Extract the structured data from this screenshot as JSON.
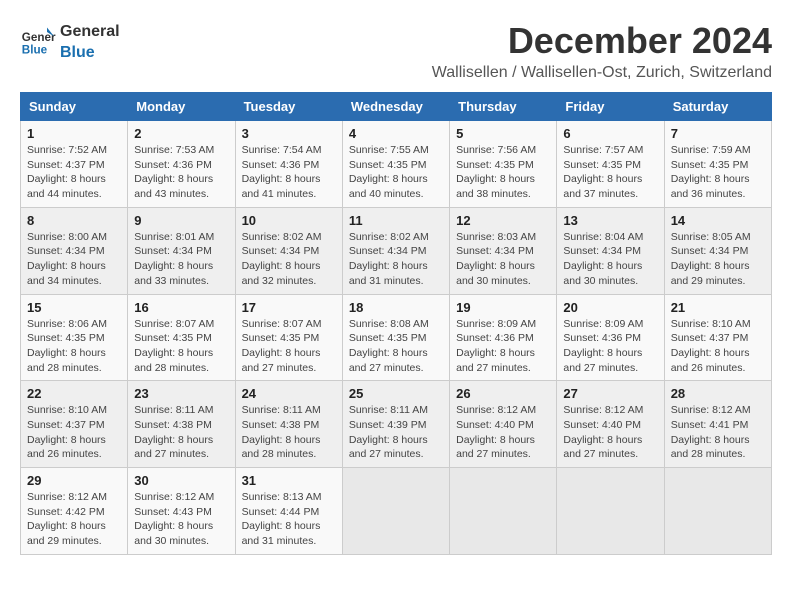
{
  "header": {
    "logo_general": "General",
    "logo_blue": "Blue",
    "main_title": "December 2024",
    "subtitle": "Wallisellen / Wallisellen-Ost, Zurich, Switzerland"
  },
  "calendar": {
    "columns": [
      "Sunday",
      "Monday",
      "Tuesday",
      "Wednesday",
      "Thursday",
      "Friday",
      "Saturday"
    ],
    "weeks": [
      [
        null,
        null,
        null,
        null,
        null,
        null,
        null
      ]
    ]
  },
  "days": [
    {
      "day": 1,
      "sunrise": "7:52 AM",
      "sunset": "4:37 PM",
      "daylight": "8 hours and 44 minutes"
    },
    {
      "day": 2,
      "sunrise": "7:53 AM",
      "sunset": "4:36 PM",
      "daylight": "8 hours and 43 minutes"
    },
    {
      "day": 3,
      "sunrise": "7:54 AM",
      "sunset": "4:36 PM",
      "daylight": "8 hours and 41 minutes"
    },
    {
      "day": 4,
      "sunrise": "7:55 AM",
      "sunset": "4:35 PM",
      "daylight": "8 hours and 40 minutes"
    },
    {
      "day": 5,
      "sunrise": "7:56 AM",
      "sunset": "4:35 PM",
      "daylight": "8 hours and 38 minutes"
    },
    {
      "day": 6,
      "sunrise": "7:57 AM",
      "sunset": "4:35 PM",
      "daylight": "8 hours and 37 minutes"
    },
    {
      "day": 7,
      "sunrise": "7:59 AM",
      "sunset": "4:35 PM",
      "daylight": "8 hours and 36 minutes"
    },
    {
      "day": 8,
      "sunrise": "8:00 AM",
      "sunset": "4:34 PM",
      "daylight": "8 hours and 34 minutes"
    },
    {
      "day": 9,
      "sunrise": "8:01 AM",
      "sunset": "4:34 PM",
      "daylight": "8 hours and 33 minutes"
    },
    {
      "day": 10,
      "sunrise": "8:02 AM",
      "sunset": "4:34 PM",
      "daylight": "8 hours and 32 minutes"
    },
    {
      "day": 11,
      "sunrise": "8:02 AM",
      "sunset": "4:34 PM",
      "daylight": "8 hours and 31 minutes"
    },
    {
      "day": 12,
      "sunrise": "8:03 AM",
      "sunset": "4:34 PM",
      "daylight": "8 hours and 30 minutes"
    },
    {
      "day": 13,
      "sunrise": "8:04 AM",
      "sunset": "4:34 PM",
      "daylight": "8 hours and 30 minutes"
    },
    {
      "day": 14,
      "sunrise": "8:05 AM",
      "sunset": "4:34 PM",
      "daylight": "8 hours and 29 minutes"
    },
    {
      "day": 15,
      "sunrise": "8:06 AM",
      "sunset": "4:35 PM",
      "daylight": "8 hours and 28 minutes"
    },
    {
      "day": 16,
      "sunrise": "8:07 AM",
      "sunset": "4:35 PM",
      "daylight": "8 hours and 28 minutes"
    },
    {
      "day": 17,
      "sunrise": "8:07 AM",
      "sunset": "4:35 PM",
      "daylight": "8 hours and 27 minutes"
    },
    {
      "day": 18,
      "sunrise": "8:08 AM",
      "sunset": "4:35 PM",
      "daylight": "8 hours and 27 minutes"
    },
    {
      "day": 19,
      "sunrise": "8:09 AM",
      "sunset": "4:36 PM",
      "daylight": "8 hours and 27 minutes"
    },
    {
      "day": 20,
      "sunrise": "8:09 AM",
      "sunset": "4:36 PM",
      "daylight": "8 hours and 27 minutes"
    },
    {
      "day": 21,
      "sunrise": "8:10 AM",
      "sunset": "4:37 PM",
      "daylight": "8 hours and 26 minutes"
    },
    {
      "day": 22,
      "sunrise": "8:10 AM",
      "sunset": "4:37 PM",
      "daylight": "8 hours and 26 minutes"
    },
    {
      "day": 23,
      "sunrise": "8:11 AM",
      "sunset": "4:38 PM",
      "daylight": "8 hours and 27 minutes"
    },
    {
      "day": 24,
      "sunrise": "8:11 AM",
      "sunset": "4:38 PM",
      "daylight": "8 hours and 28 minutes"
    },
    {
      "day": 25,
      "sunrise": "8:11 AM",
      "sunset": "4:39 PM",
      "daylight": "8 hours and 27 minutes"
    },
    {
      "day": 26,
      "sunrise": "8:12 AM",
      "sunset": "4:40 PM",
      "daylight": "8 hours and 27 minutes"
    },
    {
      "day": 27,
      "sunrise": "8:12 AM",
      "sunset": "4:40 PM",
      "daylight": "8 hours and 27 minutes"
    },
    {
      "day": 28,
      "sunrise": "8:12 AM",
      "sunset": "4:41 PM",
      "daylight": "8 hours and 28 minutes"
    },
    {
      "day": 29,
      "sunrise": "8:12 AM",
      "sunset": "4:42 PM",
      "daylight": "8 hours and 29 minutes"
    },
    {
      "day": 30,
      "sunrise": "8:12 AM",
      "sunset": "4:43 PM",
      "daylight": "8 hours and 30 minutes"
    },
    {
      "day": 31,
      "sunrise": "8:13 AM",
      "sunset": "4:44 PM",
      "daylight": "8 hours and 31 minutes"
    }
  ],
  "weekdays": [
    "Sunday",
    "Monday",
    "Tuesday",
    "Wednesday",
    "Thursday",
    "Friday",
    "Saturday"
  ]
}
